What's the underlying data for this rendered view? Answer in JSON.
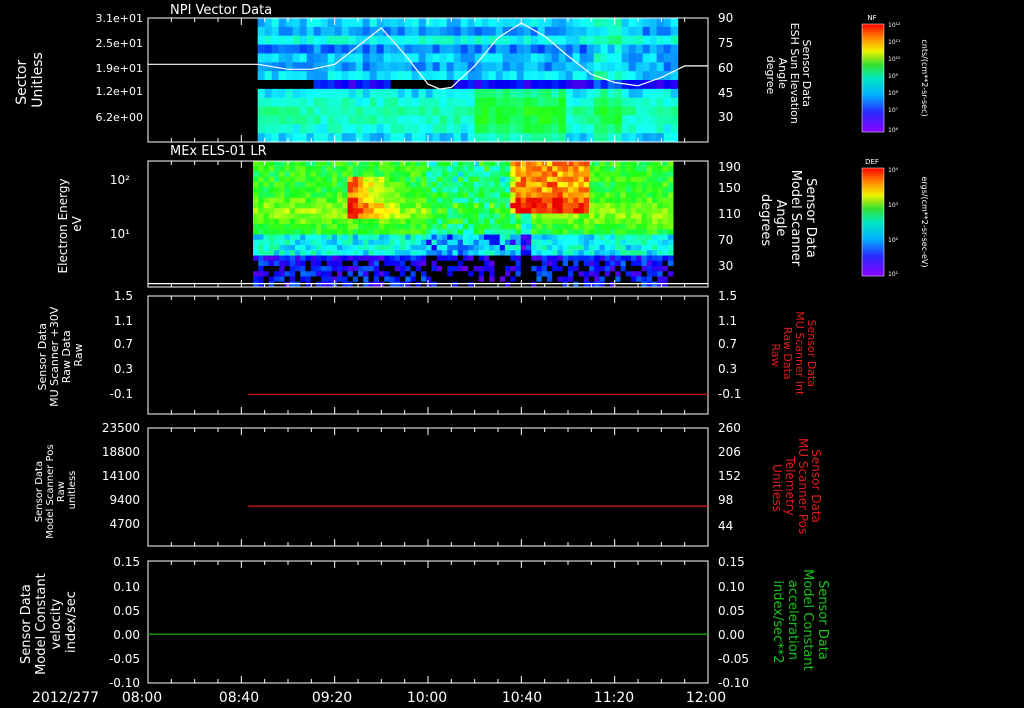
{
  "time_axis": {
    "date_label": "2012/277",
    "start": "08:00",
    "end": "12:00",
    "tick_labels": [
      "08:00",
      "08:40",
      "09:20",
      "10:00",
      "10:40",
      "11:20",
      "12:00"
    ]
  },
  "colorbars": [
    {
      "label": "NF",
      "ticks": [
        "10¹²",
        "10¹¹",
        "10¹⁰",
        "10⁹",
        "10⁸",
        "10⁷",
        "10⁶"
      ],
      "units": "cnts/(cm**2-sr-sec)"
    },
    {
      "label": "DEF",
      "ticks": [
        "10⁴",
        "10³",
        "10²",
        "10¹"
      ],
      "units": "ergs/(cm**2-sr-sec-eV)"
    }
  ],
  "chart_data": [
    {
      "type": "heatmap",
      "title": "NPI Vector Data",
      "ylabel": [
        "Sector",
        "Unitless"
      ],
      "y_tick_labels": [
        "3.1e+01",
        "2.5e+01",
        "1.9e+01",
        "1.2e+01",
        "6.2e+00"
      ],
      "data_start": "08:47",
      "data_end": "11:47",
      "overlay_line": {
        "name": "Sensor Data ESH Sun Elevation Angle",
        "right_ylabel": [
          "Sensor Data",
          "ESH Sun Elevation",
          "Angle",
          "degree"
        ],
        "right_tick_labels": [
          "90",
          "75",
          "60",
          "45",
          "30"
        ],
        "ylim": [
          15,
          90
        ],
        "x": [
          "08:00",
          "08:47",
          "09:00",
          "09:10",
          "09:20",
          "09:30",
          "09:40",
          "09:50",
          "10:00",
          "10:05",
          "10:10",
          "10:20",
          "10:30",
          "10:40",
          "10:50",
          "11:00",
          "11:10",
          "11:20",
          "11:30",
          "11:40",
          "11:50",
          "12:00"
        ],
        "y": [
          62.0,
          62.0,
          59.0,
          59.0,
          62.0,
          73.0,
          84.0,
          68.0,
          50.0,
          47.0,
          48.0,
          61.0,
          78.0,
          87.0,
          79.0,
          67.0,
          56.0,
          51.0,
          49.0,
          54.0,
          61.0,
          61.0
        ],
        "color": "#ffffff"
      }
    },
    {
      "type": "heatmap",
      "title": "MEx ELS-01 LR",
      "ylabel": [
        "Electron Energy",
        "eV"
      ],
      "y_tick_labels": [
        "10²",
        "10¹"
      ],
      "data_start": "08:45",
      "data_end": "11:45",
      "overlay_line": {
        "name": "Sensor Data Model Scanner Angle",
        "right_ylabel": [
          "Sensor Data",
          "Model Scanner",
          "Angle",
          "degrees"
        ],
        "right_tick_labels": [
          "190",
          "150",
          "110",
          "70",
          "30"
        ],
        "ylim": [
          5,
          190
        ],
        "x": [
          "08:00",
          "12:00"
        ],
        "y": [
          10,
          10
        ],
        "color": "#ffffff"
      }
    },
    {
      "type": "line",
      "ylabel": [
        "Sensor Data",
        "MU Scanner +30V",
        "Raw Data",
        "Raw"
      ],
      "right_ylabel": [
        "Sensor Data",
        "MU Scanner Int",
        "Raw Data",
        "Raw"
      ],
      "y_tick_labels": [
        "1.5",
        "1.1",
        "0.7",
        "0.3",
        "-0.1"
      ],
      "right_tick_labels": [
        "1.5",
        "1.1",
        "0.7",
        "0.3",
        "-0.1"
      ],
      "ylim": [
        -0.3,
        1.5
      ],
      "series": [
        {
          "x": [
            "08:43",
            "12:00"
          ],
          "values": [
            0.0,
            0.0
          ],
          "color": "#e01b1b"
        }
      ]
    },
    {
      "type": "line",
      "ylabel": [
        "Sensor Data",
        "Model Scanner Pos",
        "Raw",
        "unitless"
      ],
      "right_ylabel": [
        "Sensor Data",
        "MU Scanner Pos",
        "Telemetry",
        "Unitless"
      ],
      "y_tick_labels": [
        "23500",
        "18800",
        "14100",
        "9400",
        "4700"
      ],
      "right_tick_labels": [
        "260",
        "206",
        "152",
        "98",
        "44"
      ],
      "ylim": [
        0,
        23500
      ],
      "series": [
        {
          "x": [
            "08:43",
            "12:00"
          ],
          "values": [
            7950,
            7950
          ],
          "color": "#e01b1b"
        }
      ]
    },
    {
      "type": "line",
      "ylabel": [
        "Sensor Data",
        "Model Constant",
        "velocity",
        "index/sec"
      ],
      "right_ylabel": [
        "Sensor Data",
        "Model Constant",
        "acceleration",
        "index/sec**2"
      ],
      "y_tick_labels": [
        "0.15",
        "0.10",
        "0.05",
        "0.00",
        "-0.05",
        "-0.10"
      ],
      "right_tick_labels": [
        "0.15",
        "0.10",
        "0.05",
        "0.00",
        "-0.05",
        "-0.10"
      ],
      "ylim": [
        -0.1,
        0.15
      ],
      "series": [
        {
          "x": [
            "08:00",
            "12:00"
          ],
          "values": [
            0.0,
            0.0
          ],
          "color": "#18c418"
        }
      ]
    }
  ]
}
